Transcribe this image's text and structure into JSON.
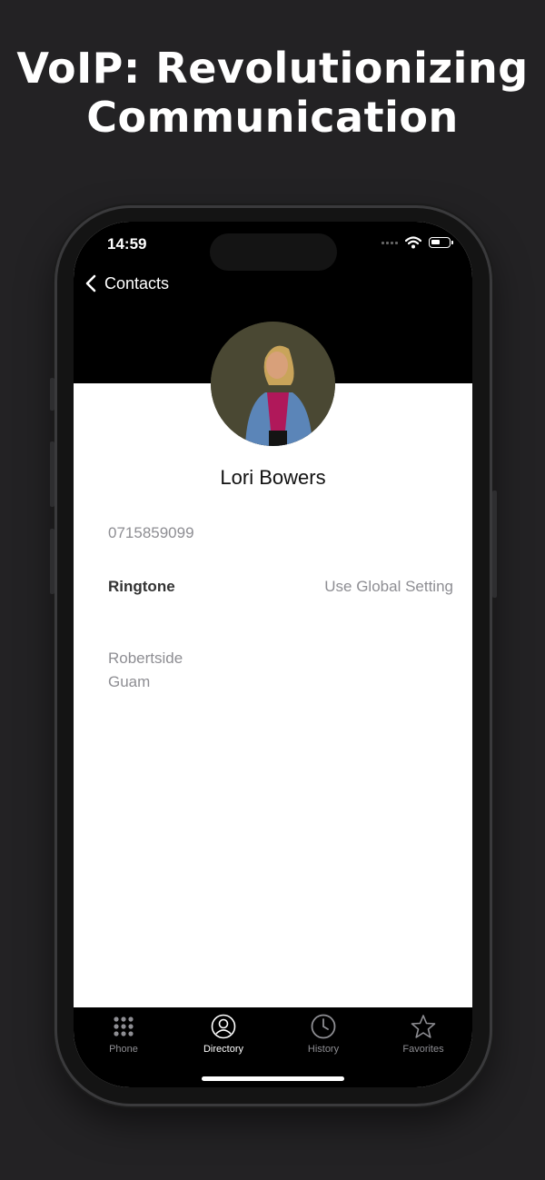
{
  "promo": {
    "headline_line1": "VoIP: Revolutionizing",
    "headline_line2": "Communication"
  },
  "status_bar": {
    "time": "14:59"
  },
  "nav": {
    "back_label": "Contacts"
  },
  "contact": {
    "name": "Lori Bowers",
    "phone": "0715859099",
    "ringtone_label": "Ringtone",
    "ringtone_value": "Use Global Setting",
    "address_line1": "Robertside",
    "address_line2": "Guam"
  },
  "tabbar": {
    "tabs": [
      {
        "label": "Phone",
        "icon": "keypad-icon"
      },
      {
        "label": "Directory",
        "icon": "person-circle-icon",
        "active": true
      },
      {
        "label": "History",
        "icon": "clock-icon"
      },
      {
        "label": "Favorites",
        "icon": "star-icon"
      }
    ]
  },
  "colors": {
    "background": "#232224",
    "header": "#000000",
    "secondary_text": "#8e8e93",
    "active_tab": "#ffffff"
  }
}
